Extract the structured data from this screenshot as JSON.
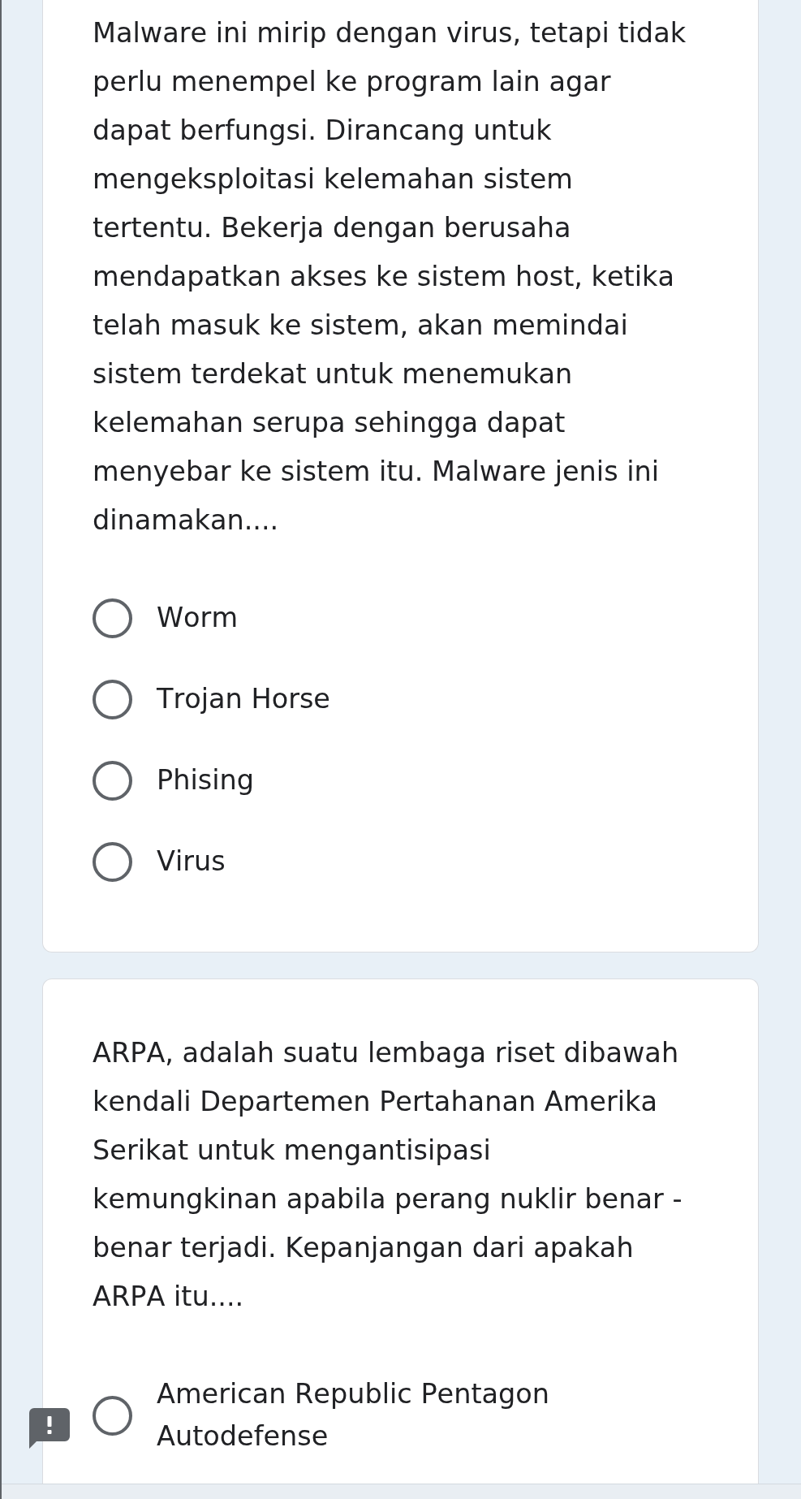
{
  "questions": [
    {
      "text": "Malware ini mirip dengan virus, tetapi tidak perlu menempel ke program lain agar dapat berfungsi. Dirancang untuk mengeksploitasi kelemahan sistem tertentu. Bekerja dengan berusaha mendapatkan akses ke sistem host, ketika telah masuk ke sistem, akan memindai sistem terdekat untuk menemukan kelemahan serupa sehingga dapat menyebar ke sistem itu. Malware jenis ini dinamakan....",
      "options": [
        {
          "label": "Worm",
          "selected": false
        },
        {
          "label": "Trojan Horse",
          "selected": false
        },
        {
          "label": "Phising",
          "selected": false
        },
        {
          "label": "Virus",
          "selected": false
        }
      ]
    },
    {
      "text": "ARPA, adalah suatu lembaga riset dibawah kendali Departemen Pertahanan Amerika Serikat untuk mengantisipasi kemungkinan apabila perang nuklir benar - benar terjadi. Kepanjangan dari apakah ARPA itu....",
      "options": [
        {
          "label": "American Republic Pentagon Autodefense",
          "selected": false
        }
      ]
    }
  ]
}
